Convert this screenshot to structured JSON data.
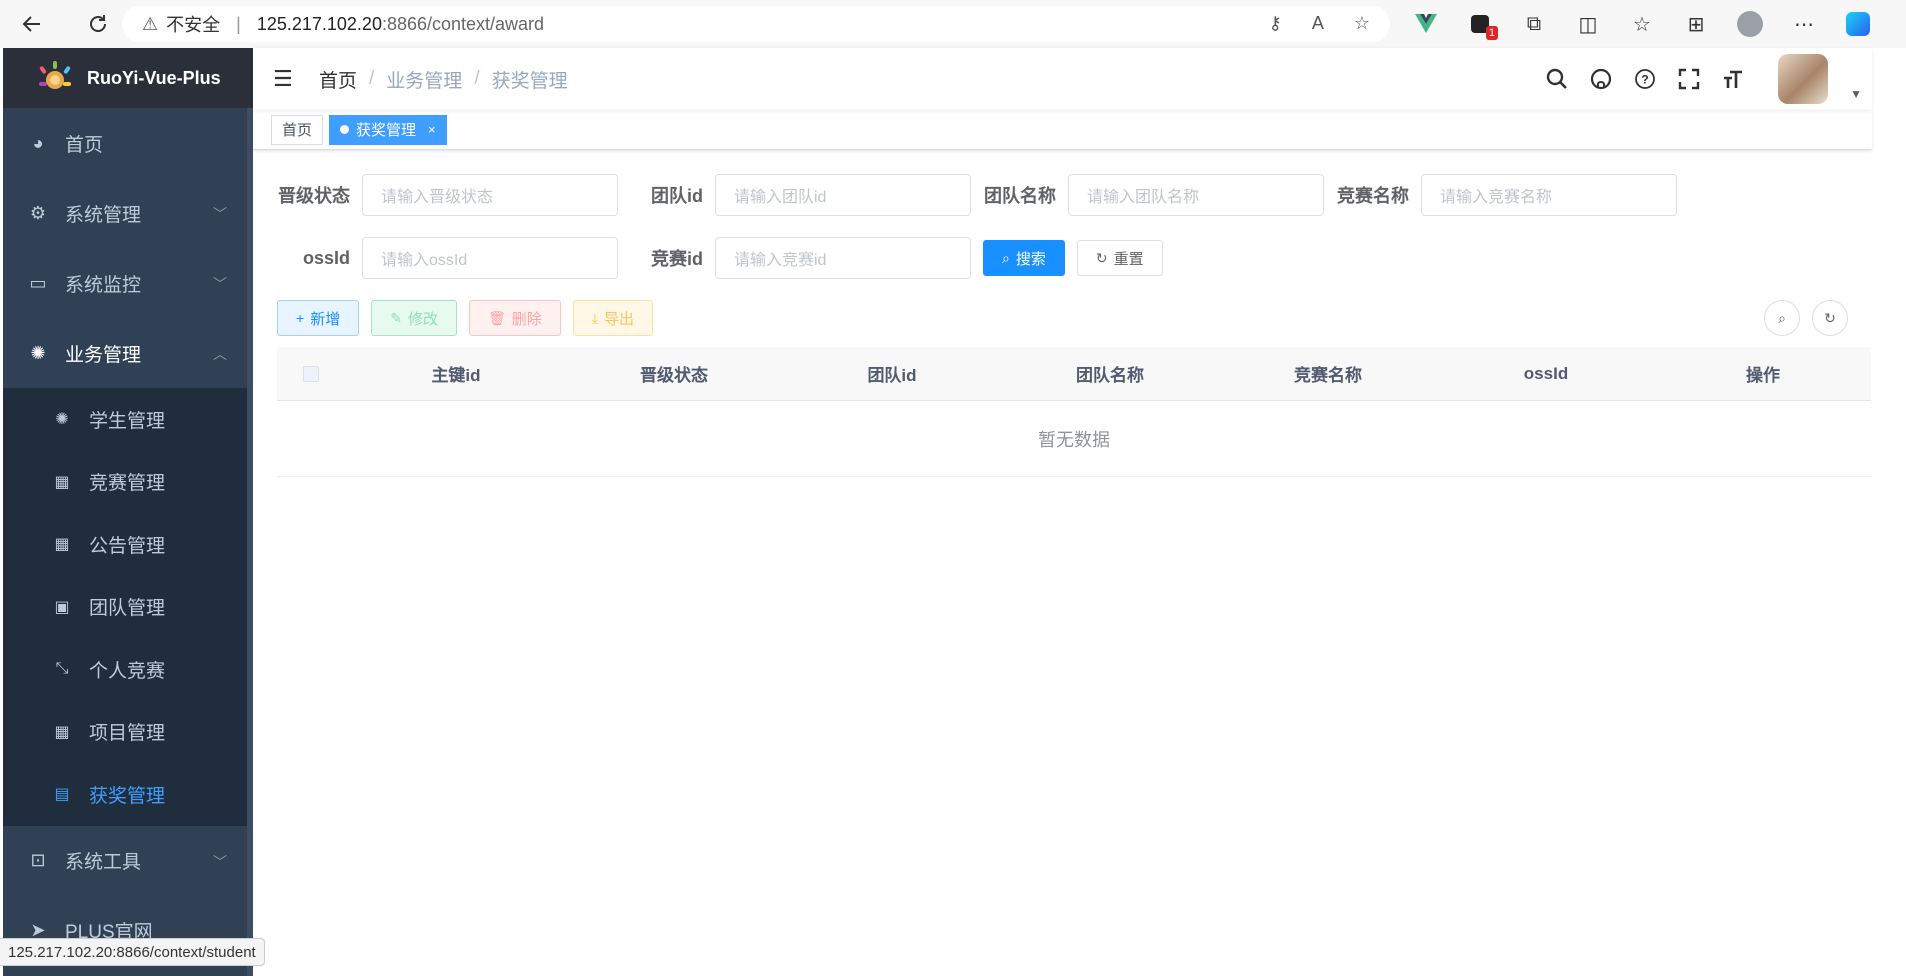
{
  "browser": {
    "insecure_label": "不安全",
    "url_host": "125.217.102.20",
    "url_path": ":8866/context/award",
    "ext_badge": "1"
  },
  "sidebar": {
    "app_title": "RuoYi-Vue-Plus",
    "items": [
      {
        "label": "首页"
      },
      {
        "label": "系统管理"
      },
      {
        "label": "系统监控"
      },
      {
        "label": "业务管理"
      }
    ],
    "submenu": [
      {
        "label": "学生管理"
      },
      {
        "label": "竞赛管理"
      },
      {
        "label": "公告管理"
      },
      {
        "label": "团队管理"
      },
      {
        "label": "个人竞赛"
      },
      {
        "label": "项目管理"
      },
      {
        "label": "获奖管理"
      }
    ],
    "tools": {
      "label": "系统工具"
    },
    "official": {
      "label": "PLUS官网"
    }
  },
  "navbar": {
    "breadcrumb": [
      "首页",
      "业务管理",
      "获奖管理"
    ],
    "separator": "/"
  },
  "tags": {
    "home": "首页",
    "active": "获奖管理",
    "close": "×"
  },
  "search_form": {
    "fields": [
      {
        "label": "晋级状态",
        "placeholder": "请输入晋级状态"
      },
      {
        "label": "团队id",
        "placeholder": "请输入团队id"
      },
      {
        "label": "团队名称",
        "placeholder": "请输入团队名称"
      },
      {
        "label": "竞赛名称",
        "placeholder": "请输入竞赛名称"
      },
      {
        "label": "ossId",
        "placeholder": "请输入ossId"
      },
      {
        "label": "竞赛id",
        "placeholder": "请输入竞赛id"
      }
    ],
    "search_button": "搜索",
    "reset_button": "重置"
  },
  "toolbar": {
    "add": "新增",
    "edit": "修改",
    "delete": "删除",
    "export": "导出"
  },
  "table": {
    "columns": [
      "主键id",
      "晋级状态",
      "团队id",
      "团队名称",
      "竞赛名称",
      "ossId",
      "操作"
    ],
    "empty_text": "暂无数据"
  },
  "status_url": "125.217.102.20:8866/context/student",
  "colors": {
    "sidebar_bg": "#304156",
    "submenu_bg": "#1f2d3d",
    "accent": "#409eff",
    "primary_button": "#1890ff"
  }
}
